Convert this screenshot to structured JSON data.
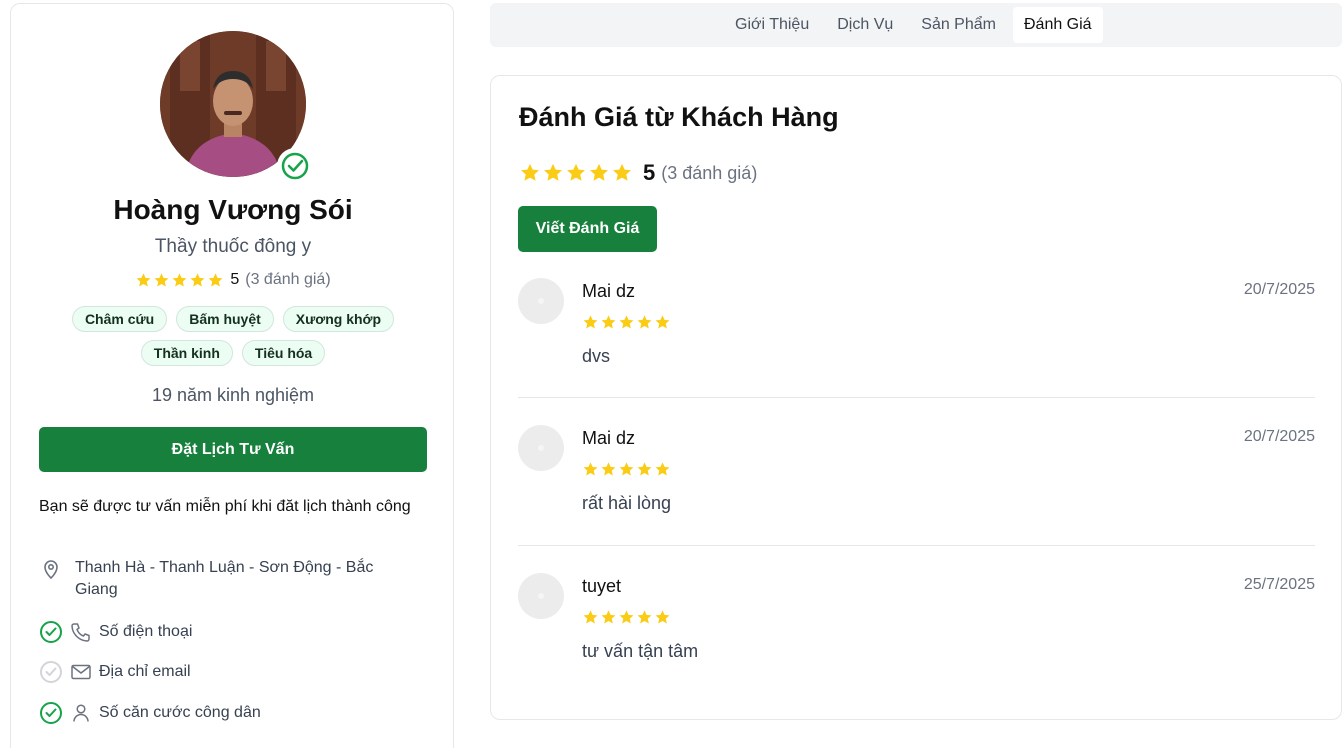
{
  "profile": {
    "name": "Hoàng Vương Sói",
    "title": "Thầy thuốc đông y",
    "rating": "5",
    "rating_count": "(3 đánh giá)",
    "tags": [
      "Châm cứu",
      "Bấm huyệt",
      "Xương khớp",
      "Thần kinh",
      "Tiêu hóa"
    ],
    "experience": "19 năm kinh nghiệm",
    "book_button": "Đặt Lịch Tư Vấn",
    "free_note": "Bạn sẽ được tư vấn miễn phí khi đăt lịch thành công",
    "address_line1": "Thanh Hà - Thanh Luận - Sơn Động - Bắc",
    "address_line2": "Giang",
    "verifications": [
      {
        "label": "Số điện thoại",
        "verified": true,
        "icon": "phone-icon"
      },
      {
        "label": "Địa chỉ email",
        "verified": false,
        "icon": "mail-icon"
      },
      {
        "label": "Số căn cước công dân",
        "verified": true,
        "icon": "user-icon"
      }
    ]
  },
  "tabs": [
    {
      "label": "Giới Thiệu",
      "active": false
    },
    {
      "label": "Dịch Vụ",
      "active": false
    },
    {
      "label": "Sản Phẩm",
      "active": false
    },
    {
      "label": "Đánh Giá",
      "active": true
    }
  ],
  "reviews_section": {
    "title": "Đánh Giá từ Khách Hàng",
    "average": "5",
    "count": "(3 đánh giá)",
    "write_button": "Viết Đánh Giá",
    "reviews": [
      {
        "name": "Mai dz",
        "date": "20/7/2025",
        "rating": 5,
        "text": "dvs"
      },
      {
        "name": "Mai dz",
        "date": "20/7/2025",
        "rating": 5,
        "text": "rất hài lòng"
      },
      {
        "name": "tuyet",
        "date": "25/7/2025",
        "rating": 5,
        "text": "tư vấn tận tâm"
      }
    ]
  },
  "colors": {
    "primary_green": "#16803c",
    "star_yellow": "#facc15",
    "tag_bg": "#ecfdf3",
    "verified_green": "#16a34a",
    "unverified_gray": "#d1d5db"
  }
}
